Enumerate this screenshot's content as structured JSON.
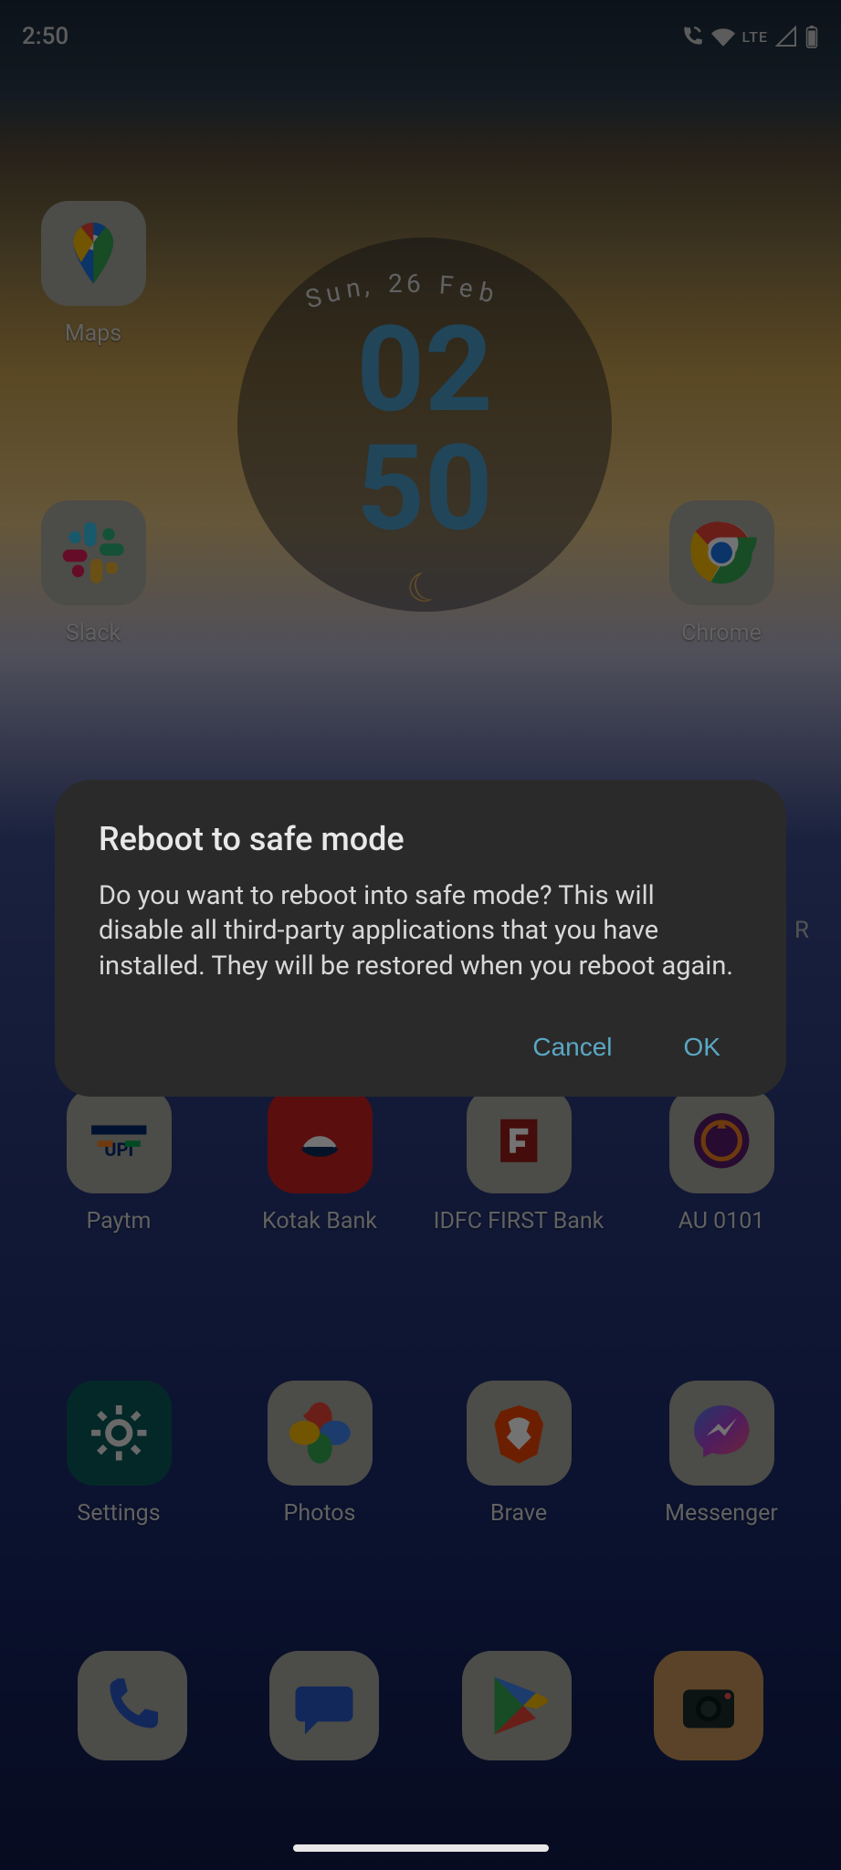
{
  "status": {
    "time": "2:50",
    "network_label": "LTE"
  },
  "clock": {
    "date": "Sun, 26 Feb",
    "hours": "02",
    "minutes": "50"
  },
  "apps": {
    "maps": "Maps",
    "slack": "Slack",
    "chrome": "Chrome",
    "paytm": "Paytm",
    "kotak": "Kotak Bank",
    "idfc": "IDFC FIRST Bank",
    "au": "AU 0101",
    "settings": "Settings",
    "photos": "Photos",
    "brave": "Brave",
    "messenger": "Messenger"
  },
  "peek_letter": "R",
  "dialog": {
    "title": "Reboot to safe mode",
    "body": "Do you want to reboot into safe mode? This will disable all third-party applications that you have installed. They will be restored when you reboot again.",
    "cancel": "Cancel",
    "ok": "OK"
  }
}
